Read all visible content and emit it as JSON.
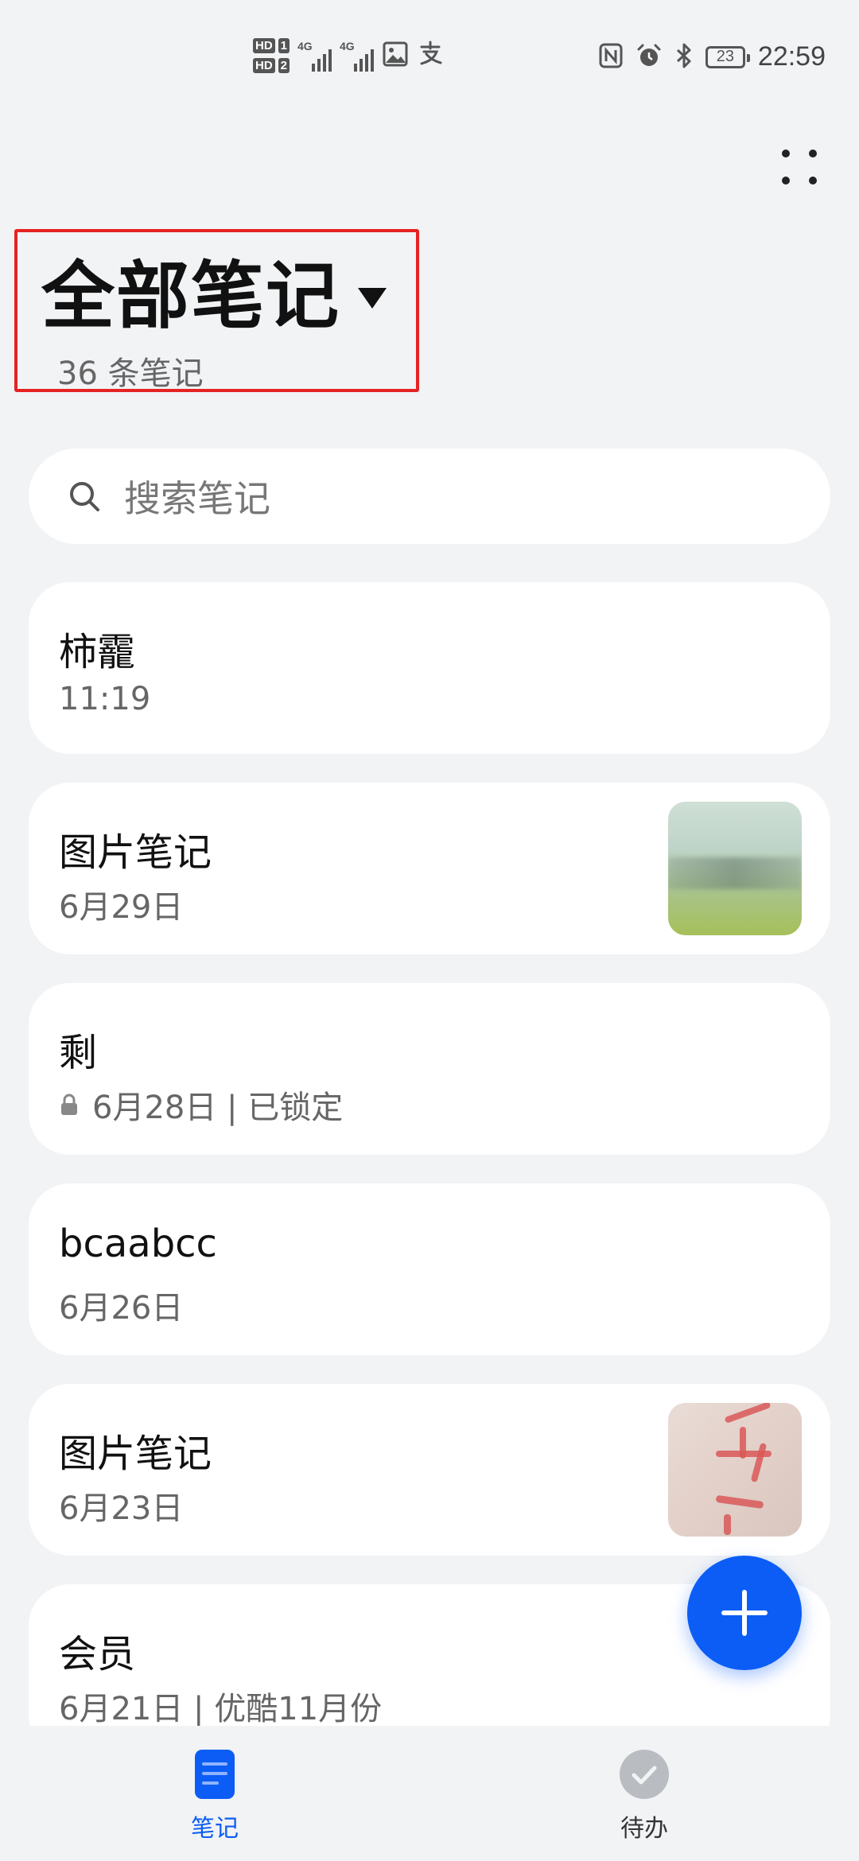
{
  "status_bar": {
    "hd1": "HD",
    "sim1": "1",
    "hd2": "HD",
    "sim2": "2",
    "net1": "4G",
    "net2": "4G",
    "battery": "23",
    "time": "22:59"
  },
  "header": {
    "title": "全部笔记",
    "count_label": "36 条笔记"
  },
  "search": {
    "placeholder": "搜索笔记"
  },
  "notes": [
    {
      "title": "柿靇",
      "meta": "11:19",
      "has_image": false,
      "locked": false
    },
    {
      "title": "图片笔记",
      "meta": "6月29日",
      "has_image": true,
      "locked": false
    },
    {
      "title": "剩",
      "meta": "6月28日 | 已锁定",
      "has_image": false,
      "locked": true
    },
    {
      "title": "bcaabcc",
      "meta": "6月26日",
      "has_image": false,
      "locked": false
    },
    {
      "title": "图片笔记",
      "meta": "6月23日",
      "has_image": true,
      "locked": false
    },
    {
      "title": "会员",
      "meta": "6月21日 | 优酷11月份",
      "has_image": false,
      "locked": false
    }
  ],
  "bottom_nav": {
    "notes_label": "笔记",
    "todo_label": "待办",
    "active": "notes"
  },
  "colors": {
    "accent": "#0b5df5",
    "highlight_border": "#e62222",
    "background": "#f1f3f5"
  },
  "icons": [
    "more-dots-icon",
    "dropdown-caret-icon",
    "search-icon",
    "lock-icon",
    "plus-icon",
    "notes-tab-icon",
    "todo-check-icon"
  ]
}
